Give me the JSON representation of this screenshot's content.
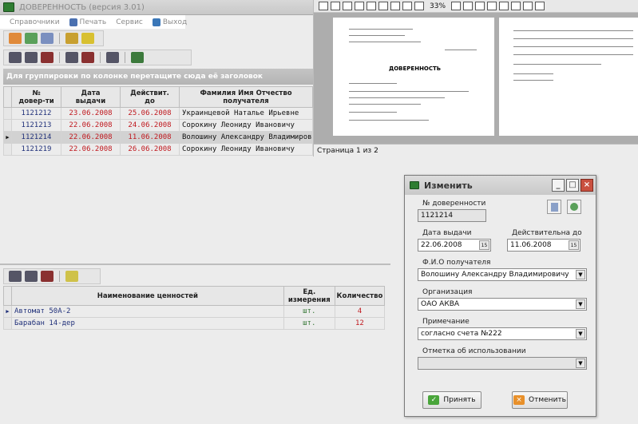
{
  "app": {
    "title": "ДОВЕРЕННОСТЬ (версия 3.01)"
  },
  "menu": [
    {
      "label": "Справочники",
      "icon": "",
      "color": ""
    },
    {
      "label": "Печать",
      "icon": "printer-icon",
      "color": "#4a70b0"
    },
    {
      "label": "Сервис",
      "icon": "",
      "color": ""
    },
    {
      "label": "Выход",
      "icon": "exit-door-icon",
      "color": "#3a77b8"
    }
  ],
  "main": {
    "group_hint": "Для группировки по колонке перетащите сюда её заголовок",
    "columns": {
      "num": "№\nдовер-ти",
      "issue": "Дата\nвыдачи",
      "valid": "Действит.\nдо",
      "name": "Фамилия Имя Отчество\nполучателя"
    },
    "rows": [
      {
        "num": "1121212",
        "issue": "23.06.2008",
        "valid": "25.06.2008",
        "name": "Украинцевой  Наталье  Ирьевне",
        "selected": false
      },
      {
        "num": "1121213",
        "issue": "22.06.2008",
        "valid": "24.06.2008",
        "name": "Сорокину  Леониду  Ивановичу",
        "selected": false
      },
      {
        "num": "1121214",
        "issue": "22.06.2008",
        "valid": "11.06.2008",
        "name": "Волошину  Александру  Владимиров",
        "selected": true
      },
      {
        "num": "1121219",
        "issue": "22.06.2008",
        "valid": "26.06.2008",
        "name": "Сорокину  Леониду  Ивановичу",
        "selected": false
      }
    ]
  },
  "items": {
    "columns": {
      "name": "Наименование ценностей",
      "unit": "Ед.\nизмерения",
      "qty": "Количество"
    },
    "rows": [
      {
        "name": "Автомат  50А-2",
        "unit": "шт.",
        "qty": "4"
      },
      {
        "name": "Барабан 14-дер",
        "unit": "шт.",
        "qty": "12"
      }
    ]
  },
  "preview": {
    "zoom": "33%",
    "status": "Страница 1 из 2",
    "doc_title": "ДОВЕРЕННОСТЬ"
  },
  "dialog": {
    "title": "Изменить",
    "num_label": "№ доверенности",
    "num_value": "1121214",
    "issue_label": "Дата выдачи",
    "issue_value": "22.06.2008",
    "valid_label": "Действительна до",
    "valid_value": "11.06.2008",
    "recipient_label": "Ф.И.О получателя",
    "recipient_value": "Волошину Александру Владимировичу",
    "org_label": "Организация",
    "org_value": "ОАО АКВА",
    "note_label": "Примечание",
    "note_value": "согласно счета №222",
    "usage_label": "Отметка об использовании",
    "usage_value": "",
    "ok_label": "Принять",
    "cancel_label": "Отменить"
  },
  "colors": {
    "blue_text": "#21317a",
    "red_text": "#c0181e",
    "selected_row": "#d2d2d2"
  }
}
